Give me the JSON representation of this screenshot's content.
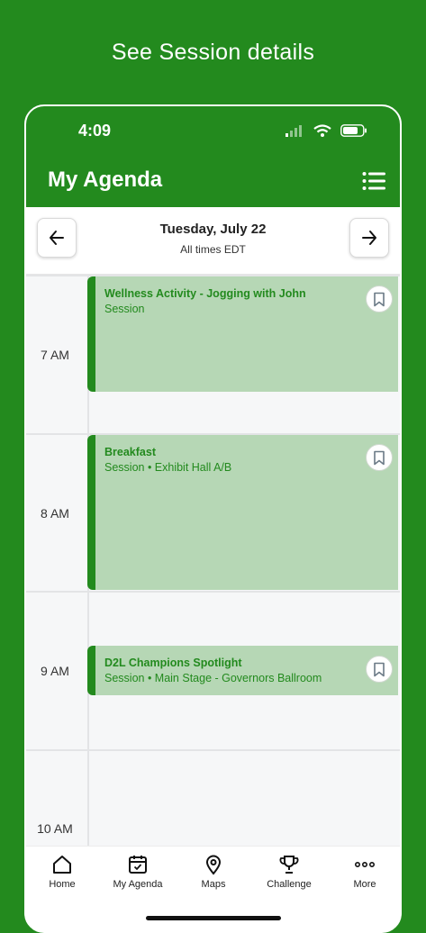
{
  "promo": {
    "headline": "See Session details"
  },
  "status_bar": {
    "time": "4:09"
  },
  "header": {
    "title": "My Agenda"
  },
  "date_nav": {
    "date": "Tuesday, July 22",
    "timezone": "All times EDT"
  },
  "timeline": {
    "hours": [
      "7 AM",
      "8 AM",
      "9 AM",
      "10 AM"
    ],
    "events": [
      {
        "title": "Wellness Activity - Jogging with John",
        "subtitle": "Session"
      },
      {
        "title": "Breakfast",
        "subtitle": "Session • Exhibit Hall A/B"
      },
      {
        "title": "D2L Champions Spotlight",
        "subtitle": "Session • Main Stage - Governors Ballroom"
      }
    ]
  },
  "tabbar": {
    "items": [
      {
        "label": "Home",
        "icon": "home-icon"
      },
      {
        "label": "My Agenda",
        "icon": "calendar-check-icon"
      },
      {
        "label": "Maps",
        "icon": "map-pin-icon"
      },
      {
        "label": "Challenge",
        "icon": "trophy-icon"
      },
      {
        "label": "More",
        "icon": "more-dots-icon"
      }
    ]
  },
  "colors": {
    "brand_green": "#238a1e",
    "event_fill": "#b6d7b5"
  }
}
